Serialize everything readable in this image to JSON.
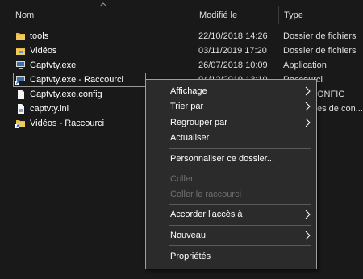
{
  "columns": {
    "name": "Nom",
    "date": "Modifié le",
    "type": "Type"
  },
  "files": [
    {
      "name": "tools",
      "date": "22/10/2018 14:26",
      "type": "Dossier de fichiers",
      "icon": "folder-icon"
    },
    {
      "name": "Vidéos",
      "date": "03/11/2019 17:20",
      "type": "Dossier de fichiers",
      "icon": "folder-icon"
    },
    {
      "name": "Captvty.exe",
      "date": "26/07/2018 10:09",
      "type": "Application",
      "icon": "exe-icon"
    },
    {
      "name": "Captvty.exe - Raccourci",
      "date": "04/12/2019 13:10",
      "type": "Raccourci",
      "icon": "shortcut-icon"
    },
    {
      "name": "Captvty.exe.config",
      "date": "",
      "type": "ONFIG",
      "icon": "file-icon"
    },
    {
      "name": "captvty.ini",
      "date": "",
      "type": "es de con...",
      "icon": "ini-icon"
    },
    {
      "name": "Vidéos - Raccourci",
      "date": "",
      "type": "",
      "icon": "folder-shortcut-icon"
    }
  ],
  "context_menu": {
    "items": [
      {
        "label": "Affichage",
        "submenu": true,
        "disabled": false
      },
      {
        "label": "Trier par",
        "submenu": true,
        "disabled": false
      },
      {
        "label": "Regrouper par",
        "submenu": true,
        "disabled": false
      },
      {
        "label": "Actualiser",
        "submenu": false,
        "disabled": false
      },
      {
        "label": "Personnaliser ce dossier...",
        "submenu": false,
        "disabled": false
      },
      {
        "label": "Coller",
        "submenu": false,
        "disabled": true
      },
      {
        "label": "Coller le raccourci",
        "submenu": false,
        "disabled": true
      },
      {
        "label": "Accorder l'accès à",
        "submenu": true,
        "disabled": false
      },
      {
        "label": "Nouveau",
        "submenu": true,
        "disabled": false
      },
      {
        "label": "Propriétés",
        "submenu": false,
        "disabled": false
      }
    ]
  },
  "colors": {
    "background": "#191919",
    "menu_background": "#2b2b2b",
    "folder_yellow": "#e8b84a",
    "disabled_text": "#6f6f6f"
  }
}
